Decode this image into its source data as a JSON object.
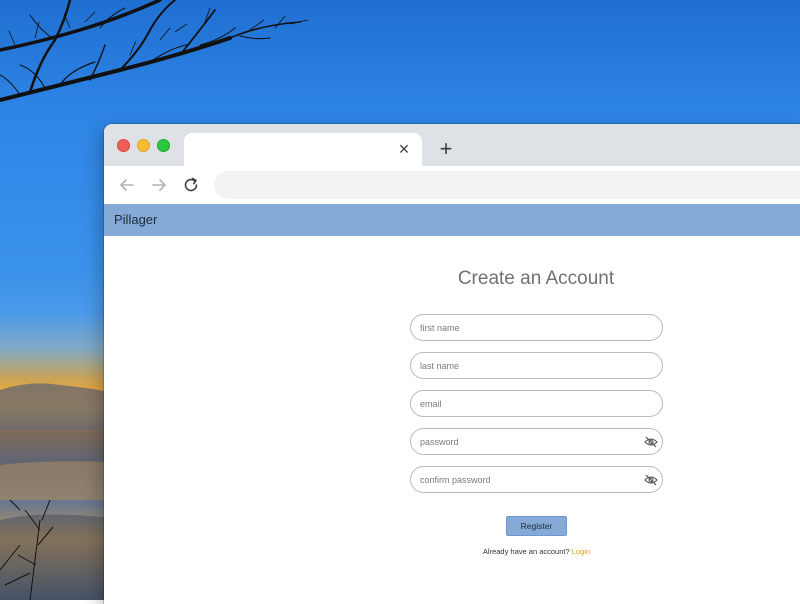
{
  "browser": {
    "tab": {
      "title": "",
      "close_glyph": "×"
    },
    "new_tab_glyph": "+",
    "address_bar": {
      "value": ""
    }
  },
  "app": {
    "brand": "Pillager",
    "header_color": "#86aad7"
  },
  "form": {
    "title": "Create an Account",
    "fields": {
      "first_name": {
        "placeholder": "first name",
        "value": ""
      },
      "last_name": {
        "placeholder": "last name",
        "value": ""
      },
      "email": {
        "placeholder": "email",
        "value": ""
      },
      "password": {
        "placeholder": "password",
        "value": "",
        "icon": "eye-off-icon"
      },
      "confirm_password": {
        "placeholder": "confirm password",
        "value": "",
        "icon": "eye-off-icon"
      }
    },
    "register_label": "Register",
    "login_prompt": "Already have an account?",
    "login_link": "Login",
    "link_color": "#e0a020"
  }
}
